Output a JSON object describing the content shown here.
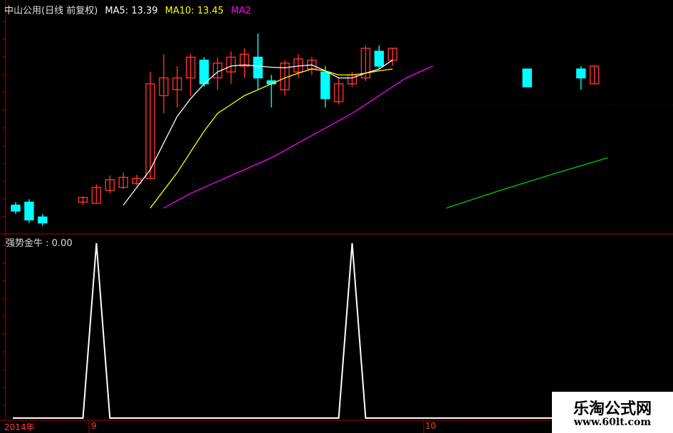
{
  "header": {
    "title": "中山公用(日线 前复权)",
    "ma5_label": "MA5: 13.39",
    "ma10_label": "MA10: 13.45",
    "ma20_label": "MA2",
    "colors": {
      "title": "#e0e0e0",
      "ma5": "#ffffff",
      "ma10": "#ffff00",
      "ma20": "#ff00ff",
      "ma_extra": "#00cc00",
      "up": "#ff3030",
      "down": "#00ffff",
      "grid": "#aa0000"
    }
  },
  "indicator": {
    "label": "强势金牛 : 0.00"
  },
  "x_axis": {
    "labels": [
      "2014年",
      "9",
      "10"
    ]
  },
  "watermark": {
    "line1": "乐淘公式网",
    "line2": "www.60lt.com"
  },
  "chart_data": [
    {
      "type": "candlestick",
      "title": "中山公用(日线 前复权)",
      "ylim": [
        10.8,
        14.5
      ],
      "candles": [
        {
          "i": 0,
          "o": 11.25,
          "h": 11.3,
          "l": 11.1,
          "c": 11.15
        },
        {
          "i": 1,
          "o": 11.3,
          "h": 11.35,
          "l": 10.95,
          "c": 11.0
        },
        {
          "i": 2,
          "o": 11.05,
          "h": 11.1,
          "l": 10.9,
          "c": 10.95
        },
        {
          "i": 5,
          "o": 11.3,
          "h": 11.4,
          "l": 11.25,
          "c": 11.38
        },
        {
          "i": 6,
          "o": 11.28,
          "h": 11.6,
          "l": 11.28,
          "c": 11.55
        },
        {
          "i": 7,
          "o": 11.5,
          "h": 11.75,
          "l": 11.45,
          "c": 11.68
        },
        {
          "i": 8,
          "o": 11.55,
          "h": 11.8,
          "l": 11.52,
          "c": 11.72
        },
        {
          "i": 9,
          "o": 11.62,
          "h": 11.76,
          "l": 11.58,
          "c": 11.7
        },
        {
          "i": 10,
          "o": 11.7,
          "h": 13.5,
          "l": 11.68,
          "c": 13.3
        },
        {
          "i": 11,
          "o": 13.1,
          "h": 13.8,
          "l": 12.8,
          "c": 13.4
        },
        {
          "i": 12,
          "o": 13.2,
          "h": 13.6,
          "l": 12.9,
          "c": 13.4
        },
        {
          "i": 13,
          "o": 13.4,
          "h": 13.8,
          "l": 13.1,
          "c": 13.75
        },
        {
          "i": 14,
          "o": 13.7,
          "h": 13.75,
          "l": 13.25,
          "c": 13.3
        },
        {
          "i": 15,
          "o": 13.4,
          "h": 13.75,
          "l": 13.2,
          "c": 13.65
        },
        {
          "i": 16,
          "o": 13.5,
          "h": 13.85,
          "l": 13.3,
          "c": 13.75
        },
        {
          "i": 17,
          "o": 13.6,
          "h": 13.9,
          "l": 13.4,
          "c": 13.8
        },
        {
          "i": 18,
          "o": 13.75,
          "h": 14.15,
          "l": 13.2,
          "c": 13.4
        },
        {
          "i": 19,
          "o": 13.35,
          "h": 13.45,
          "l": 12.9,
          "c": 13.3
        },
        {
          "i": 20,
          "o": 13.2,
          "h": 13.7,
          "l": 13.1,
          "c": 13.65
        },
        {
          "i": 21,
          "o": 13.5,
          "h": 13.8,
          "l": 13.4,
          "c": 13.72
        },
        {
          "i": 22,
          "o": 13.55,
          "h": 13.75,
          "l": 13.45,
          "c": 13.7
        },
        {
          "i": 23,
          "o": 13.5,
          "h": 13.6,
          "l": 12.9,
          "c": 13.05
        },
        {
          "i": 24,
          "o": 13.0,
          "h": 13.4,
          "l": 12.95,
          "c": 13.3
        },
        {
          "i": 25,
          "o": 13.3,
          "h": 13.5,
          "l": 13.25,
          "c": 13.45
        },
        {
          "i": 26,
          "o": 13.4,
          "h": 13.95,
          "l": 13.35,
          "c": 13.9
        },
        {
          "i": 27,
          "o": 13.85,
          "h": 13.95,
          "l": 13.55,
          "c": 13.6
        },
        {
          "i": 28,
          "o": 13.7,
          "h": 13.9,
          "l": 13.6,
          "c": 13.9
        },
        {
          "i": 38,
          "o": 13.55,
          "h": 13.55,
          "l": 13.25,
          "c": 13.25
        },
        {
          "i": 42,
          "o": 13.55,
          "h": 13.6,
          "l": 13.2,
          "c": 13.4
        },
        {
          "i": 43,
          "o": 13.3,
          "h": 13.6,
          "l": 13.3,
          "c": 13.6
        }
      ],
      "series": [
        {
          "name": "MA5",
          "color": "#ffffff",
          "points": [
            [
              8,
              11.25
            ],
            [
              9,
              11.55
            ],
            [
              10,
              11.85
            ],
            [
              11,
              12.3
            ],
            [
              12,
              12.75
            ],
            [
              13,
              13.05
            ],
            [
              14,
              13.3
            ],
            [
              15,
              13.5
            ],
            [
              16,
              13.6
            ],
            [
              17,
              13.62
            ],
            [
              18,
              13.6
            ],
            [
              19,
              13.58
            ],
            [
              20,
              13.57
            ],
            [
              21,
              13.6
            ],
            [
              22,
              13.62
            ],
            [
              23,
              13.52
            ],
            [
              24,
              13.4
            ],
            [
              25,
              13.4
            ],
            [
              26,
              13.48
            ],
            [
              27,
              13.55
            ],
            [
              28,
              13.7
            ]
          ]
        },
        {
          "name": "MA10",
          "color": "#ffff00",
          "points": [
            [
              10,
              11.2
            ],
            [
              11,
              11.5
            ],
            [
              12,
              11.8
            ],
            [
              13,
              12.15
            ],
            [
              14,
              12.5
            ],
            [
              15,
              12.8
            ],
            [
              16,
              12.95
            ],
            [
              17,
              13.1
            ],
            [
              18,
              13.2
            ],
            [
              19,
              13.3
            ],
            [
              20,
              13.4
            ],
            [
              21,
              13.48
            ],
            [
              22,
              13.55
            ],
            [
              23,
              13.52
            ],
            [
              24,
              13.45
            ],
            [
              25,
              13.45
            ],
            [
              26,
              13.48
            ],
            [
              27,
              13.52
            ],
            [
              28,
              13.55
            ]
          ]
        },
        {
          "name": "MA20",
          "color": "#ff00ff",
          "points": [
            [
              11,
              11.2
            ],
            [
              13,
              11.45
            ],
            [
              15,
              11.65
            ],
            [
              17,
              11.85
            ],
            [
              19,
              12.05
            ],
            [
              21,
              12.3
            ],
            [
              23,
              12.55
            ],
            [
              25,
              12.8
            ],
            [
              27,
              13.1
            ],
            [
              29,
              13.4
            ],
            [
              31,
              13.6
            ]
          ]
        },
        {
          "name": "",
          "color": "#00cc00",
          "points": [
            [
              32,
              11.2
            ],
            [
              36,
              11.5
            ],
            [
              40,
              11.78
            ],
            [
              44,
              12.05
            ]
          ]
        }
      ]
    },
    {
      "type": "line",
      "title": "强势金牛",
      "ylim": [
        0,
        1
      ],
      "series": [
        {
          "name": "强势金牛",
          "values": [
            0,
            0,
            0,
            0,
            0,
            0,
            1,
            0,
            0,
            0,
            0,
            0,
            0,
            0,
            0,
            0,
            0,
            0,
            0,
            0,
            0,
            0,
            0,
            0,
            0,
            1,
            0,
            0,
            0,
            0,
            0,
            0,
            0,
            0,
            0,
            0,
            0,
            0,
            0,
            0,
            0,
            0,
            0,
            0,
            0
          ]
        }
      ]
    }
  ]
}
